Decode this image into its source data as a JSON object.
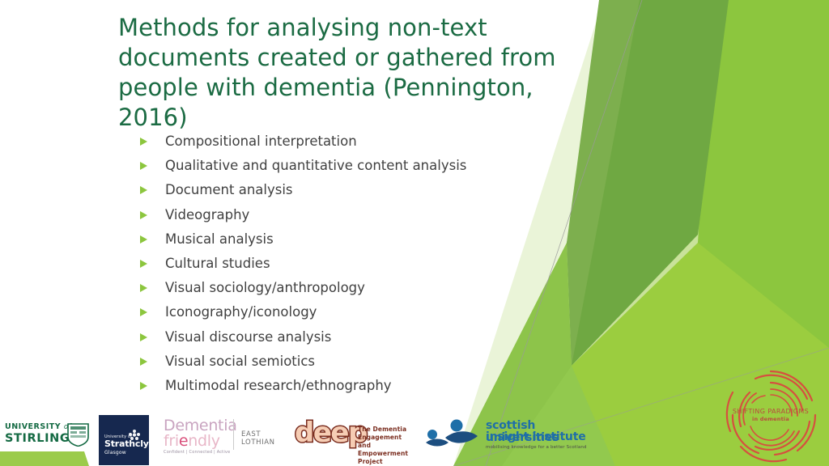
{
  "slide": {
    "title": "Methods for analysing non-text documents created or gathered from people with dementia (Pennington, 2016)",
    "bullets": [
      "Compositional interpretation",
      "Qualitative and quantitative content analysis",
      "Document analysis",
      "Videography",
      "Musical analysis",
      "Cultural studies",
      "Visual sociology/anthropology",
      "Iconography/iconology",
      "Visual discourse analysis",
      "Visual social semiotics",
      "Multimodal research/ethnography"
    ]
  },
  "logos": {
    "stirling": {
      "line1_prefix": "UNIVERSITY ",
      "line1_suffix": "of",
      "line2": "STIRLING"
    },
    "strathclyde": {
      "line1": "University of",
      "line2": "Strathclyde",
      "line3": "Glasgow"
    },
    "dementia_friendly": {
      "line1": "Dementia",
      "line2_a": "fri",
      "line2_dot": "e",
      "line2_b": "ndly",
      "tagline": "Confident | Connected | Active",
      "region": "EAST LOTHIAN"
    },
    "deep": {
      "word": "deep",
      "sub_line1": "The Dementia Engagement",
      "sub_line2": "and Empowerment Project"
    },
    "suii": {
      "line1": "scottish universities",
      "line2": "insight institute",
      "tagline": "mobilising knowledge for a better Scotland"
    },
    "shifting_paradigms": {
      "line1": "SHIFTING PARADIGMS",
      "line2": "in dementia"
    }
  },
  "colors": {
    "title_green": "#1B6B43",
    "bullet_green": "#8CC63E",
    "body_text": "#404040",
    "strathclyde_navy": "#16284F",
    "deep_brown": "#7B2E20",
    "suii_blue": "#1F6FA8",
    "paradigms_red": "#B94A3E",
    "deco_green_dark": "#6FA842",
    "deco_green_mid": "#8CC63E",
    "deco_green_light": "#C9E29B",
    "deco_green_pale": "#EAF4D8"
  }
}
